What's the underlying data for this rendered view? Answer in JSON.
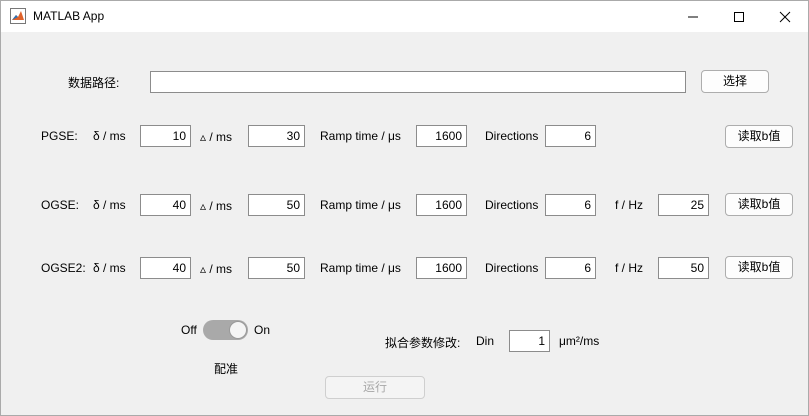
{
  "window": {
    "title": "MATLAB App",
    "minimize_icon": "minimize-icon",
    "maximize_icon": "maximize-icon",
    "close_icon": "close-icon"
  },
  "path_row": {
    "label": "数据路径:",
    "value": "",
    "select_button": "选择"
  },
  "pgse": {
    "label": "PGSE:",
    "delta_label": "δ / ms",
    "delta_value": "10",
    "Delta_label": "▵ / ms",
    "Delta_value": "30",
    "ramp_label": "Ramp time / μs",
    "ramp_value": "1600",
    "dir_label": "Directions",
    "dir_value": "6",
    "read_button": "读取b值"
  },
  "ogse": {
    "label": "OGSE:",
    "delta_label": "δ / ms",
    "delta_value": "40",
    "Delta_label": "▵ / ms",
    "Delta_value": "50",
    "ramp_label": "Ramp time / μs",
    "ramp_value": "1600",
    "dir_label": "Directions",
    "dir_value": "6",
    "f_label": "f / Hz",
    "f_value": "25",
    "read_button": "读取b值"
  },
  "ogse2": {
    "label": "OGSE2:",
    "delta_label": "δ / ms",
    "delta_value": "40",
    "Delta_label": "▵ / ms",
    "Delta_value": "50",
    "ramp_label": "Ramp time / μs",
    "ramp_value": "1600",
    "dir_label": "Directions",
    "dir_value": "6",
    "f_label": "f / Hz",
    "f_value": "50",
    "read_button": "读取b值"
  },
  "registration": {
    "off_label": "Off",
    "on_label": "On",
    "state": "on",
    "caption": "配准"
  },
  "fit": {
    "label": "拟合参数修改:",
    "din_label": "Din",
    "din_value": "1",
    "unit": "μm²/ms"
  },
  "run_button": "运行"
}
